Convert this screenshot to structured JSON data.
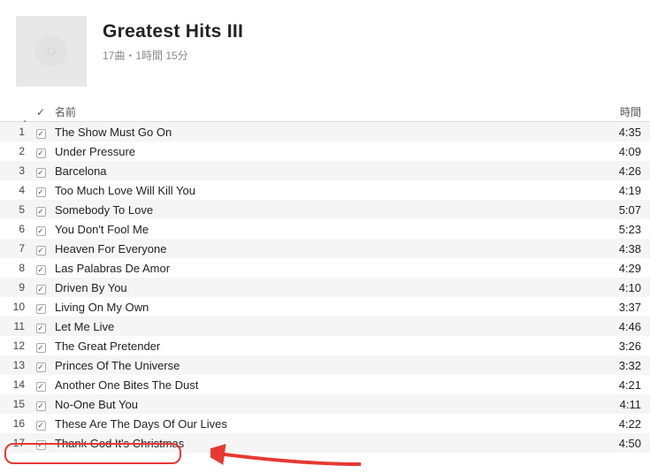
{
  "album": {
    "title": "Greatest Hits III",
    "meta": "17曲・1時間 15分"
  },
  "columns": {
    "check": "✓",
    "name": "名前",
    "time": "時間"
  },
  "tracks": [
    {
      "num": "1",
      "name": "The Show Must Go On",
      "time": "4:35"
    },
    {
      "num": "2",
      "name": "Under Pressure",
      "time": "4:09"
    },
    {
      "num": "3",
      "name": "Barcelona",
      "time": "4:26"
    },
    {
      "num": "4",
      "name": "Too Much Love Will Kill You",
      "time": "4:19"
    },
    {
      "num": "5",
      "name": "Somebody To Love",
      "time": "5:07"
    },
    {
      "num": "6",
      "name": "You Don't Fool Me",
      "time": "5:23"
    },
    {
      "num": "7",
      "name": "Heaven For Everyone",
      "time": "4:38"
    },
    {
      "num": "8",
      "name": "Las Palabras De Amor",
      "time": "4:29"
    },
    {
      "num": "9",
      "name": "Driven By You",
      "time": "4:10"
    },
    {
      "num": "10",
      "name": "Living On My Own",
      "time": "3:37"
    },
    {
      "num": "11",
      "name": "Let Me Live",
      "time": "4:46"
    },
    {
      "num": "12",
      "name": "The Great Pretender",
      "time": "3:26"
    },
    {
      "num": "13",
      "name": "Princes Of The Universe",
      "time": "3:32"
    },
    {
      "num": "14",
      "name": "Another One Bites The Dust",
      "time": "4:21"
    },
    {
      "num": "15",
      "name": "No-One But You",
      "time": "4:11"
    },
    {
      "num": "16",
      "name": "These Are The Days Of Our Lives",
      "time": "4:22"
    },
    {
      "num": "17",
      "name": "Thank God It's Christmas",
      "time": "4:50"
    }
  ]
}
